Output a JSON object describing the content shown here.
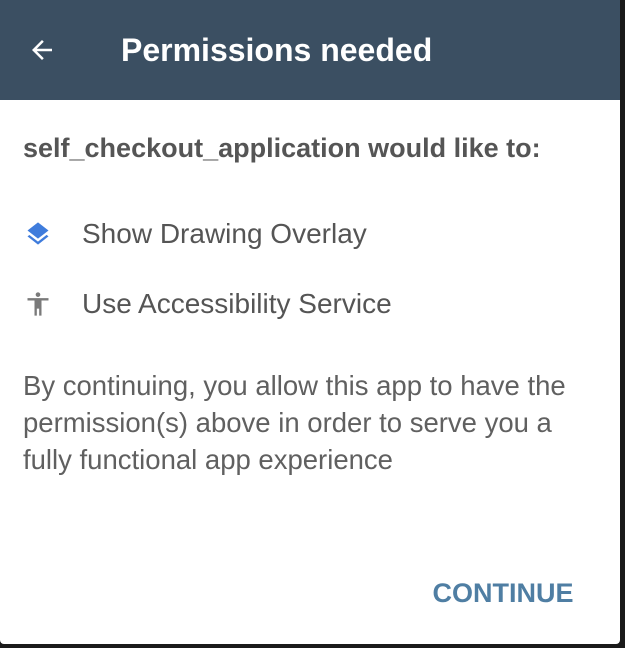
{
  "appbar": {
    "back_icon": "arrow-back-icon",
    "title": "Permissions needed",
    "background": "#3b4f62"
  },
  "dialog": {
    "heading": "self_checkout_application would like to:",
    "permissions": [
      {
        "icon": "layers-icon",
        "label": "Show Drawing Overlay",
        "icon_color": "#3f7cdc"
      },
      {
        "icon": "accessibility-icon",
        "label": "Use Accessibility Service",
        "icon_color": "#7a7a7a"
      }
    ],
    "description": "By continuing, you allow this app to have the permission(s) above in order to serve you a fully functional app experience",
    "continue_label": "CONTINUE",
    "accent": "#4f7ea3"
  }
}
